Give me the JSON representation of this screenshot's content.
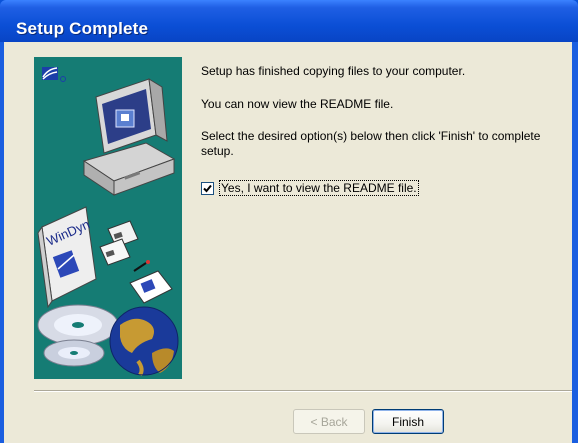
{
  "window": {
    "title": "Setup Complete"
  },
  "messages": {
    "line1": "Setup has finished copying files to your computer.",
    "line2": "You can now view the README file.",
    "line3a": "Select the desired option(s) below then click 'Finish' to complete",
    "line3b": "setup."
  },
  "readme_option": {
    "label": "Yes, I want to view the README file.",
    "checked": true
  },
  "side_panel": {
    "book_text": "WinDyn"
  },
  "buttons": {
    "back": "< Back",
    "finish": "Finish"
  },
  "colors": {
    "titlebar": "#0b4fd6",
    "panel_teal": "#157c74",
    "dialog_bg": "#ece9d8"
  }
}
